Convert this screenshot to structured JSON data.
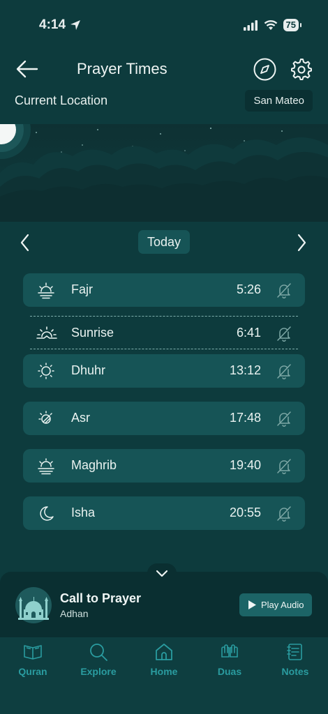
{
  "status": {
    "time": "4:14",
    "battery": "75"
  },
  "header": {
    "title": "Prayer Times"
  },
  "location": {
    "label": "Current Location",
    "city": "San Mateo"
  },
  "day_nav": {
    "label": "Today"
  },
  "prayers": [
    {
      "name": "Fajr",
      "time": "5:26",
      "icon": "fajr-icon"
    },
    {
      "name": "Sunrise",
      "time": "6:41",
      "icon": "sunrise-icon"
    },
    {
      "name": "Dhuhr",
      "time": "13:12",
      "icon": "dhuhr-icon"
    },
    {
      "name": "Asr",
      "time": "17:48",
      "icon": "asr-icon"
    },
    {
      "name": "Maghrib",
      "time": "19:40",
      "icon": "maghrib-icon"
    },
    {
      "name": "Isha",
      "time": "20:55",
      "icon": "isha-icon"
    }
  ],
  "player": {
    "title": "Call to Prayer",
    "subtitle": "Adhan",
    "button": "Play Audio"
  },
  "tabs": [
    {
      "label": "Quran",
      "icon": "quran-icon"
    },
    {
      "label": "Explore",
      "icon": "search-icon"
    },
    {
      "label": "Home",
      "icon": "home-icon"
    },
    {
      "label": "Duas",
      "icon": "praying-hands-icon"
    },
    {
      "label": "Notes",
      "icon": "notes-icon"
    }
  ],
  "colors": {
    "background": "#0d3b3d",
    "card": "#165456",
    "accent": "#2a9ca0"
  }
}
